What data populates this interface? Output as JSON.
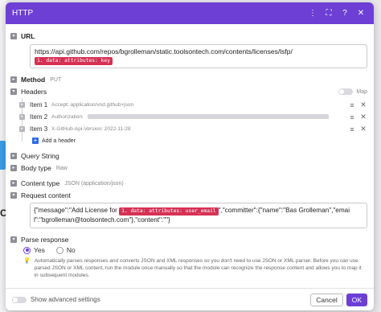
{
  "background": {
    "fragment_text": "C"
  },
  "dialog": {
    "title": "HTTP",
    "icons": [
      "more-vertical-icon",
      "fullscreen-icon",
      "help-icon",
      "close-icon"
    ]
  },
  "url": {
    "label": "URL",
    "value": "https://api.github.com/repos/bgrolleman/static.toolsontech.com/contents/licenses/lsfp/",
    "token": "1. data: attributes: key"
  },
  "method": {
    "label": "Method",
    "value": "PUT"
  },
  "headers": {
    "label": "Headers",
    "map_label": "Map",
    "items": [
      {
        "label": "Item 1",
        "value": "Accept: application/vnd.github+json"
      },
      {
        "label": "Item 2",
        "value": "Authorization:"
      },
      {
        "label": "Item 3",
        "value": "X-GitHub-Api-Version: 2022-11-28"
      }
    ],
    "add_label": "Add a header"
  },
  "query_string": {
    "label": "Query String"
  },
  "body_type": {
    "label": "Body type",
    "value": "Raw"
  },
  "content_type": {
    "label": "Content type",
    "value": "JSON (application/json)"
  },
  "request_content": {
    "label": "Request content",
    "part1": "{\"message\":\"Add License for ",
    "token": "1. data: attributes: user_email",
    "part2": "\",\"committer\":{\"name\":\"Bas Grolleman\",\"emai",
    "line2": "l\":\"bgrolleman@toolsontech.com\"},\"content\":\"\"}"
  },
  "parse_response": {
    "label": "Parse response",
    "yes": "Yes",
    "no": "No",
    "selected": "Yes",
    "hint": "Automatically parses responses and converts JSON and XML responses so you don't need to use JSON or XML parser. Before you can use parsed JSON or XML content, run the module once manually so that the module can recognize the response content and allows you to map it in subsequent modules."
  },
  "footer": {
    "advanced_label": "Show advanced settings",
    "cancel_label": "Cancel",
    "ok_label": "OK"
  },
  "colors": {
    "accent": "#6d3fd4",
    "token": "#d63155",
    "flow_node": "#3aa0ea"
  }
}
